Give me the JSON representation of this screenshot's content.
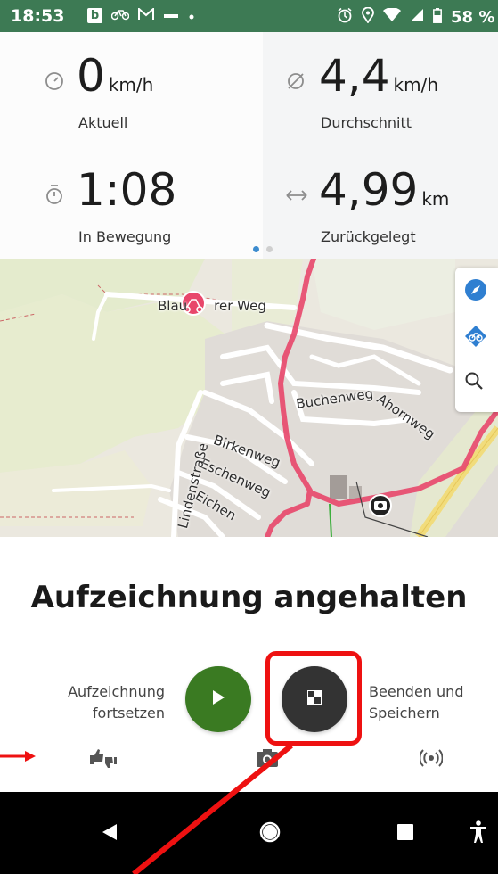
{
  "status_bar": {
    "time": "18:53",
    "left_icons": [
      "b-app-icon",
      "bike-icon",
      "gmail-icon",
      "minus-icon",
      "dot-icon"
    ],
    "b_letter": "b",
    "right_icons": [
      "alarm-icon",
      "location-icon",
      "wifi-icon",
      "signal-icon",
      "battery-icon"
    ],
    "battery": "58 %"
  },
  "stats": {
    "current_speed": {
      "value": "0",
      "unit": "km/h",
      "label": "Aktuell",
      "icon": "speedometer-icon"
    },
    "average_speed": {
      "value": "4,4",
      "unit": "km/h",
      "label": "Durchschnitt",
      "icon": "average-icon"
    },
    "moving_time": {
      "value": "1:08",
      "unit": "",
      "label": "In Bewegung",
      "icon": "stopwatch-icon"
    },
    "distance": {
      "value": "4,99",
      "unit": "km",
      "label": "Zurückgelegt",
      "icon": "distance-arrows-icon"
    },
    "pager_active_index": 0,
    "pager_count": 2
  },
  "map": {
    "street_labels": {
      "blauer_weg": "Blau",
      "blauer_weg_suffix": "rer Weg",
      "ahornweg": "Ahornweg",
      "buchenweg": "Buchenweg",
      "birkenweg": "Birkenweg",
      "eschenweg": "Eschenweg",
      "eichenweg": "Eichen",
      "lindenstrasse": "Lindenstraße"
    },
    "controls": [
      "compass-icon",
      "bike-layer-icon",
      "search-icon"
    ],
    "route_color": "#e8476b"
  },
  "recording": {
    "title": "Aufzeichnung angehalten",
    "resume_label": "Aufzeichnung fortsetzen",
    "resume_label_line1": "Aufzeichnung",
    "resume_label_line2": "fortsetzen",
    "stop_label_line1": "Beenden und",
    "stop_label_line2": "Speichern",
    "resume_color": "#3a7a22",
    "stop_color": "#333333"
  },
  "bottom_actions": [
    "thumbs-rating-icon",
    "camera-icon",
    "radio-signal-icon"
  ],
  "nav_bar": [
    "back-icon",
    "home-icon",
    "recents-icon",
    "accessibility-icon"
  ],
  "annotation": {
    "color": "#ee1111"
  }
}
